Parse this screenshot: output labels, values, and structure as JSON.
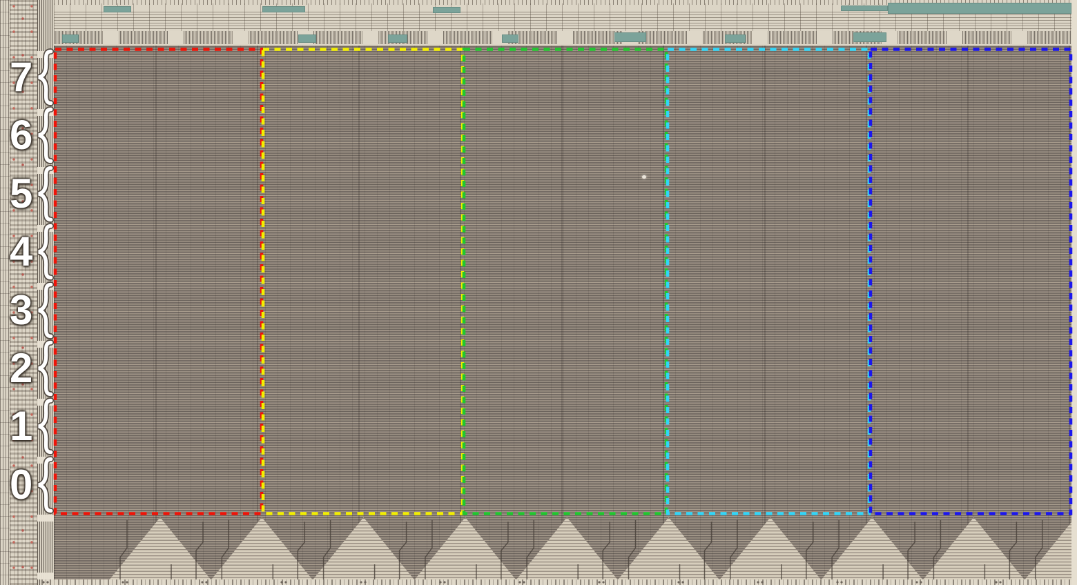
{
  "die": {
    "row_labels": [
      "7",
      "6",
      "5",
      "4",
      "3",
      "2",
      "1",
      "0"
    ],
    "brace_glyph": "{",
    "column_overlays": [
      {
        "name": "red",
        "color": "#ee1408"
      },
      {
        "name": "yellow",
        "color": "#f2ee00"
      },
      {
        "name": "green",
        "color": "#20c72f"
      },
      {
        "name": "cyan",
        "color": "#31d5f8"
      },
      {
        "name": "blue",
        "color": "#1b16ee"
      }
    ],
    "palette": {
      "array_base": "#7b7069",
      "edge_circuitry": "#dcd5c6",
      "teal_accent": "#7ba39a",
      "label_color": "#ffffff"
    }
  }
}
